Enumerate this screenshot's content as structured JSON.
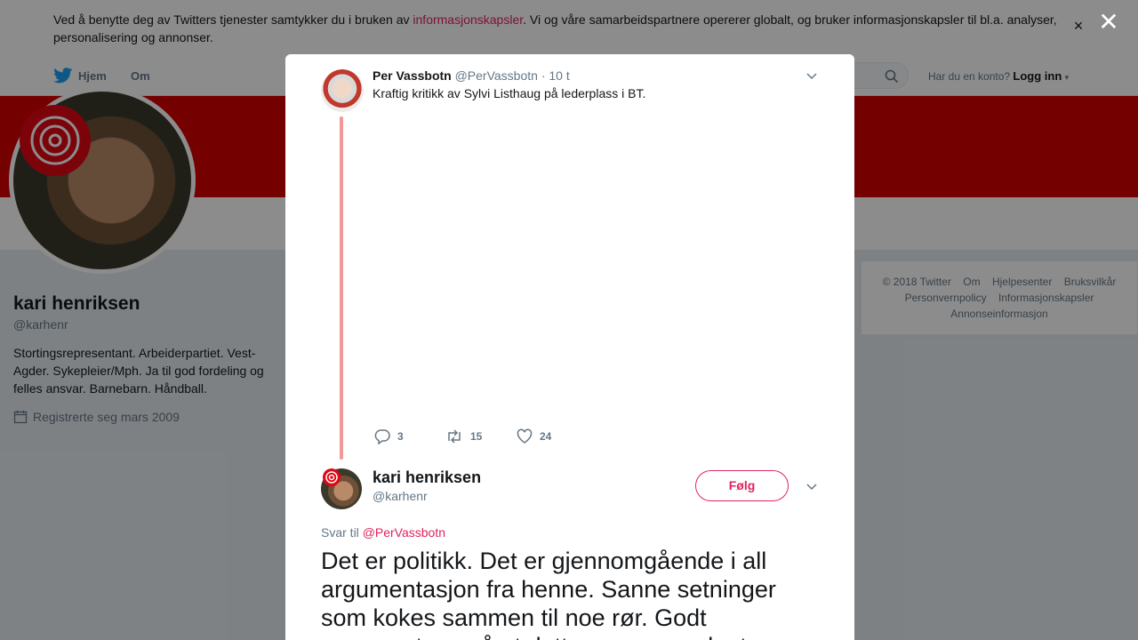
{
  "cookie": {
    "text_before": "Ved å benytte deg av Twitters tjenester samtykker du i bruken av ",
    "link": "informasjonskapsler",
    "text_after": ". Vi og våre samarbeidspartnere opererer globalt, og bruker informasjonskapsler til bl.a. analyser, personalisering og annonser.",
    "close": "×"
  },
  "nav": {
    "home": "Hjem",
    "about": "Om",
    "account_prompt": "Har du en konto?",
    "login": "Logg inn"
  },
  "profile": {
    "name": "kari henriksen",
    "handle": "@karhenr",
    "bio": "Stortingsrepresentant. Arbeiderpartiet. Vest-Agder. Sykepleier/Mph. Ja til god fordeling og felles ansvar. Barnebarn. Håndball.",
    "joined": "Registrerte seg mars 2009"
  },
  "footer": {
    "links": [
      "© 2018 Twitter",
      "Om",
      "Hjelpesenter",
      "Bruksvilkår",
      "Personvernpolicy",
      "Informasjonskapsler",
      "Annonseinformasjon"
    ]
  },
  "overlay": {
    "close": "✕"
  },
  "tweet": {
    "author_name": "Per Vassbotn",
    "author_handle": "@PerVassbotn",
    "time": "· 10 t",
    "text": "Kraftig kritikk av Sylvi Listhaug på lederplass i BT.",
    "replies": "3",
    "retweets": "15",
    "likes": "24"
  },
  "reply": {
    "author_name": "kari henriksen",
    "author_handle": "@karhenr",
    "follow": "Følg",
    "reply_to_label": "Svar til",
    "reply_to_handle": "@PerVassbotn",
    "text": "Det er politikk. Det er gjennomgående i all argumentasjon fra henne. Sanne setninger som kokes sammen til noe rør. Godt argument, og så at dette er sammenlagt"
  },
  "colors": {
    "brand_red": "#d40000",
    "accent": "#e0245e",
    "twitter_blue": "#1da1f2"
  }
}
